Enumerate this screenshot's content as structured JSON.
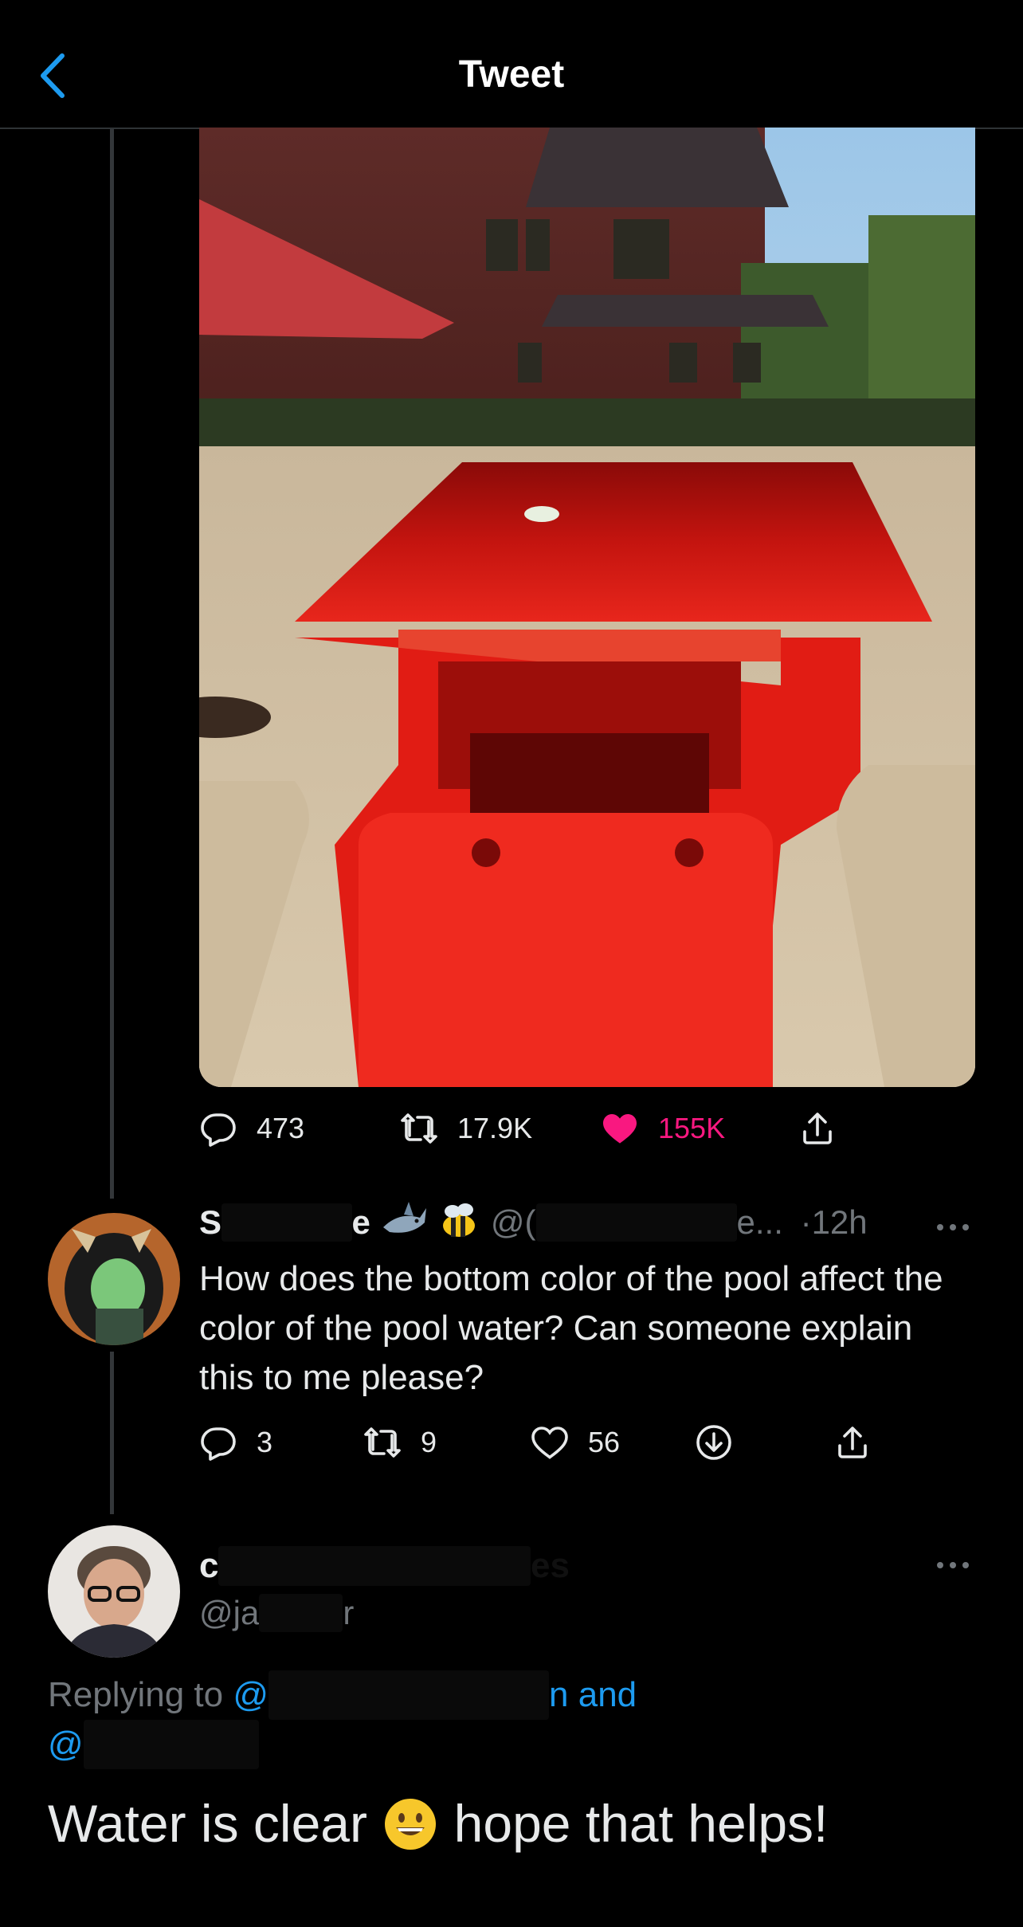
{
  "header": {
    "title": "Tweet"
  },
  "image": {
    "alt": ""
  },
  "main_actions": {
    "replies": "473",
    "retweets": "17.9K",
    "likes": "155K"
  },
  "reply": {
    "display_name_visible": "S",
    "display_name_tail": "e",
    "handle_prefix": "@(",
    "handle_tail": "e...",
    "time": "·12h",
    "text": "How does the bottom color of the pool affect the color of the pool water? Can someone explain this to me please?",
    "actions": {
      "replies": "3",
      "retweets": "9",
      "likes": "56"
    }
  },
  "focused": {
    "display_name_start": "c",
    "display_name_end": "es",
    "handle_start": "@ja",
    "handle_end": "r",
    "replying_prefix": "Replying to",
    "replying_at_1": "@",
    "replying_tail_1": "n and",
    "replying_at_2": "@",
    "text_before_emoji": "Water is clear",
    "text_after_emoji": "hope that helps!"
  },
  "colors": {
    "accent": "#1d9bf0",
    "like": "#f91880",
    "muted": "#71767b",
    "background": "#000000"
  },
  "icons": [
    "chevron-left-icon",
    "reply-icon",
    "retweet-icon",
    "heart-icon",
    "share-icon",
    "download-icon",
    "more-icon",
    "shark-emoji",
    "bee-emoji",
    "smile-emoji"
  ]
}
